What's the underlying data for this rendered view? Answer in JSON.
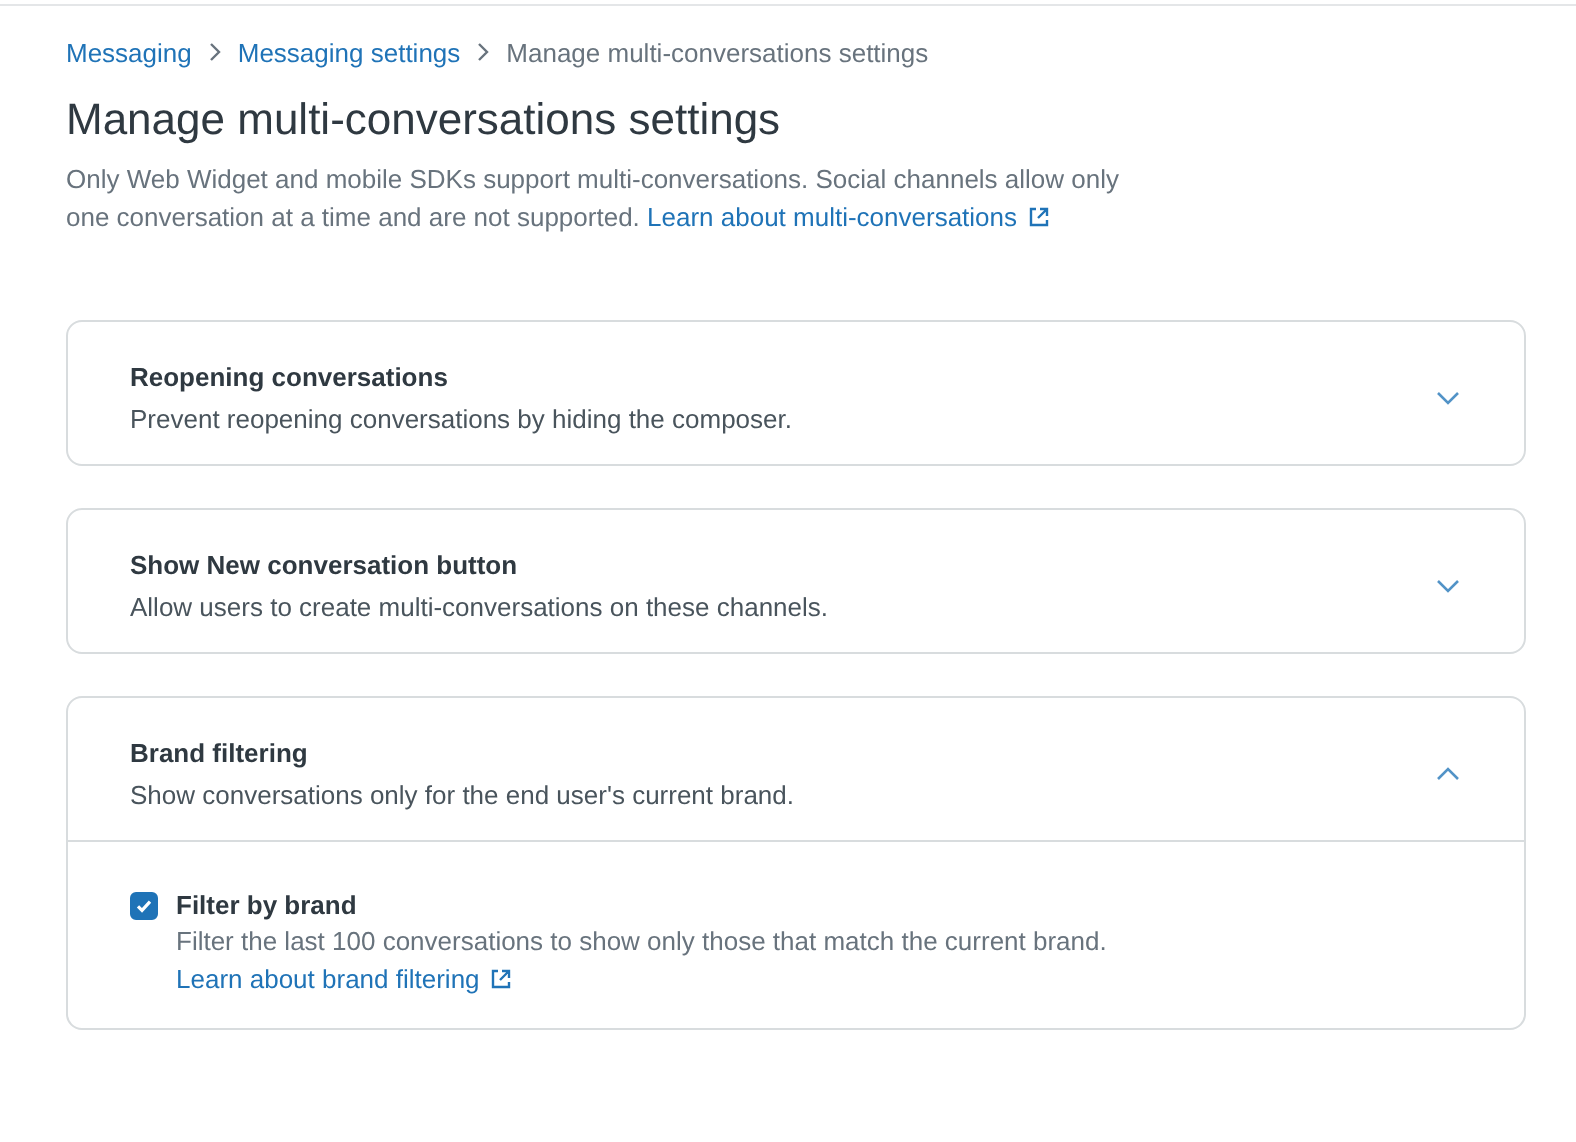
{
  "breadcrumb": [
    {
      "label": "Messaging",
      "link": true
    },
    {
      "label": "Messaging settings",
      "link": true
    },
    {
      "label": "Manage multi-conversations settings",
      "link": false
    }
  ],
  "title": "Manage multi-conversations settings",
  "description": "Only Web Widget and mobile SDKs support multi-conversations. Social channels allow only one conversation at a time and are not supported.",
  "description_link": "Learn about multi-conversations",
  "sections": [
    {
      "title": "Reopening conversations",
      "subtitle": "Prevent reopening conversations by hiding the composer.",
      "expanded": false
    },
    {
      "title": "Show New conversation button",
      "subtitle": "Allow users to create multi-conversations on these channels.",
      "expanded": false
    },
    {
      "title": "Brand filtering",
      "subtitle": "Show conversations only for the end user's current brand.",
      "expanded": true,
      "options": [
        {
          "label": "Filter by brand",
          "hint": "Filter the last 100 conversations to show only those that match the current brand.",
          "link": "Learn about brand filtering",
          "checked": true
        }
      ]
    }
  ]
}
